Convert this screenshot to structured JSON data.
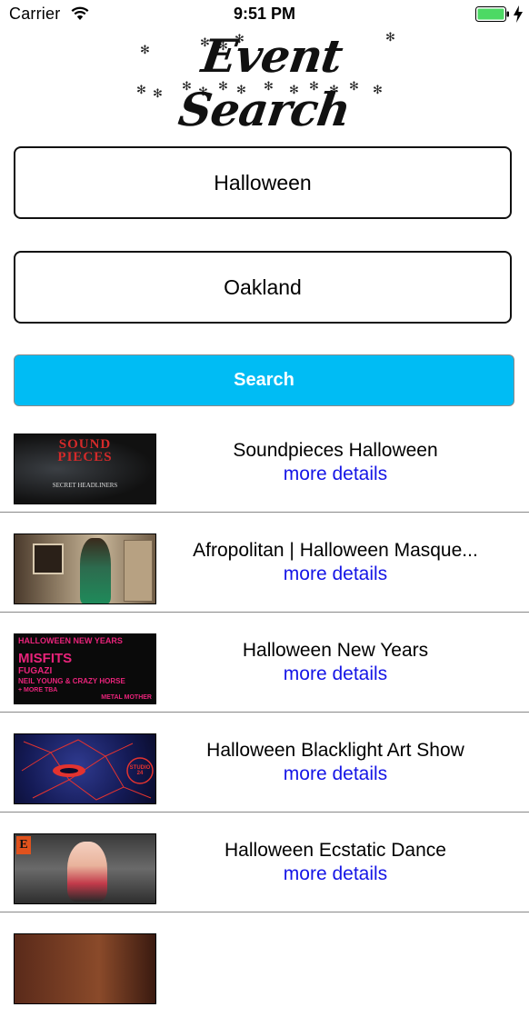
{
  "status_bar": {
    "carrier": "Carrier",
    "time": "9:51 PM"
  },
  "header": {
    "title": "Event Search"
  },
  "search": {
    "keyword": "Halloween",
    "location": "Oakland",
    "button_label": "Search"
  },
  "events": [
    {
      "title": "Soundpieces Halloween",
      "link": "more details",
      "thumb_text": [
        "SOUND",
        "PIECES",
        "SECRET HEADLINERS"
      ]
    },
    {
      "title": "Afropolitan | Halloween Masque...",
      "link": "more details",
      "thumb_text": []
    },
    {
      "title": "Halloween New Years",
      "link": "more details",
      "thumb_text": [
        "HALLOWEEN NEW YEARS",
        "MISFITS",
        "FUGAZI",
        "NEIL YOUNG & CRAZY HORSE",
        "+ MORE TBA",
        "METAL MOTHER"
      ]
    },
    {
      "title": "Halloween Blacklight Art Show",
      "link": "more details",
      "thumb_text": [
        "STUDIO 24"
      ]
    },
    {
      "title": "Halloween Ecstatic Dance",
      "link": "more details",
      "thumb_text": [
        "E"
      ]
    },
    {
      "title": "",
      "link": "",
      "thumb_text": []
    }
  ],
  "colors": {
    "accent": "#00bcf4",
    "link": "#1515e6",
    "battery": "#4cd964"
  }
}
